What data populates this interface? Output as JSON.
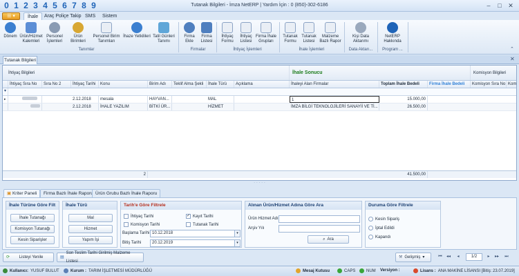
{
  "quick_numbers": [
    "0",
    "1",
    "2",
    "3",
    "4",
    "5",
    "6",
    "7",
    "8",
    "9"
  ],
  "window_title": "Tutanak Bilgileri - İmza NetERP | Yardım İçin : 0 (850)-302-6186",
  "app_menu_label": "☰ ▾",
  "ribbon_tabs": [
    "İhale",
    "Araç Poliçe Takip",
    "SMS",
    "Sistem"
  ],
  "ribbon": {
    "buttons": [
      {
        "label": "Dönem",
        "icon": "calendar-icon"
      },
      {
        "label": "Ürün/Hizmet Kalemleri",
        "icon": "products-icon"
      },
      {
        "label": "Personel İşlemleri",
        "icon": "person-icon"
      },
      {
        "label": "Ürün Birimleri",
        "icon": "coins-icon"
      },
      {
        "label": "Personel Birim Tanımları",
        "icon": "document-add-icon"
      },
      {
        "label": "İhaze Yetkilileri",
        "icon": "add-circle-icon"
      },
      {
        "label": "Tatil Günleri Tanımı",
        "icon": "holiday-icon"
      },
      {
        "label": "Firma Ekle",
        "icon": "firm-add-icon"
      },
      {
        "label": "Firma Listesi",
        "icon": "firm-list-icon"
      },
      {
        "label": "İhtiyaç Formu",
        "icon": "form-icon"
      },
      {
        "label": "İhtiyaç Listesi",
        "icon": "list-icon"
      },
      {
        "label": "Firma İhale Grupları",
        "icon": "group-icon"
      },
      {
        "label": "Tutanak Formu",
        "icon": "report-form-icon"
      },
      {
        "label": "Tutanak Listesi",
        "icon": "report-list-icon"
      },
      {
        "label": "Malzeme Bazlı Rapor",
        "icon": "chart-icon"
      },
      {
        "label": "Kişi Data Aktarımı",
        "icon": "transfer-icon"
      },
      {
        "label": "NetERP Hakkında",
        "icon": "info-icon"
      }
    ],
    "groups": [
      "Tanımlar",
      "Firmalar",
      "İhtiyaç İşlemleri",
      "İhale İşlemleri",
      "Data Aktarı...",
      "Program ..."
    ]
  },
  "doc_tab": "Tutanak Bilgileri",
  "grid": {
    "band_left": "İhtiyaç Bilgileri",
    "band_mid": "İhale Sonucu",
    "band_right": "Komisyon Bilgileri",
    "headers": [
      "İhtiyaç Sıra No",
      "Sıra No 2",
      "İhtiyaç Tarihi",
      "Konu",
      "Birim Adı",
      "Teklif Alma Şekli",
      "İhale Türü",
      "Açıklama",
      "İhaleyi Alan Firmalar",
      "Toplam İhale Bedeli",
      "Firma İhale Bedeli",
      "Komisyon Sıra No",
      "Komi"
    ],
    "rows": [
      {
        "date": "2.12.2018",
        "konu": "mesala",
        "birim": "HAYVAN...",
        "tur": "MAL",
        "firma": "1",
        "toplam": "15.000,00"
      },
      {
        "date": "2.12.2018",
        "konu": "İHALE YAZILIM",
        "birim": "BİTKİ ÜR...",
        "tur": "HİZMET",
        "firma": "İMZA BİLGİ TEKNOLOJİLERİ SANAYİİ VE Tİ...",
        "toplam": "26.500,00"
      }
    ],
    "footer_count": "2",
    "footer_total": "41.500,00"
  },
  "panel_tabs": [
    "Kriter Paneli",
    "Firma Bazlı İhale Raporu",
    "Ürün Grubu Bazlı İhale Raporu"
  ],
  "filters": {
    "ihale_turu_title": "İhale Türüne Göre Filt",
    "btn_ihale_tutanagi": "İhale Tutanağı",
    "btn_komisyon_tutanagi": "Komisyon Tutanağı",
    "btn_kesin_siparisler": "Kesin Siparişler",
    "ihale_turu2_title": "İhale Türü",
    "btn_mal": "Mal",
    "btn_hizmet": "Hizmet",
    "btn_yapim": "Yapım İşi",
    "tarih_title": "Tarih'e Göre Filtrele",
    "chk_ihtiyac": "İhtiyaç Tarihi",
    "chk_kayit": "Kayıt Tarihi",
    "chk_komisyon": "Komisyon Tarihi",
    "chk_tutanak": "Tutanak Tarihi",
    "lbl_baslama": "Başlama Tarihi",
    "val_baslama": "10.12.2018",
    "lbl_bitis": "Bitiş Tarihi",
    "val_bitis": "20.12.2019",
    "urun_title": "Alınan Ürün/Hizmet Adına Göre Ara",
    "lbl_urun": "Ürün Hizmet Adı",
    "lbl_aranan": "Arşiv Yılı",
    "btn_ara": "Ara",
    "durum_title": "Duruma Göre Filtrele",
    "rad_kesin": "Kesin Sipariş",
    "rad_iptal": "İptal Edildi",
    "rad_kapandi": "Kapandı"
  },
  "bottom": {
    "btn_refresh": "Listeyi Yenile",
    "btn_last": "Son Teslim Tarihi Girilmiş Malzeme Listesi",
    "btn_advanced": "Gelişmiş",
    "page": "1/2"
  },
  "status": {
    "user_label": "Kullanıcı:",
    "user": "YUSUF BULUT",
    "kurum_label": "Kurum :",
    "kurum": "TARIM İŞLETMESİ MÜDÜRLÜĞÜ",
    "mesaj": "Mesaj Kutusu",
    "caps": "CAPS",
    "num": "NUM",
    "versiyon": "Versiyon :",
    "lisans_label": "Lisans :",
    "lisans": "ANA MAKİNE LİSANSI [Bitiş: 23.07.2019]"
  },
  "colors": {
    "accent": "#1f64b8",
    "band_green": "#1a7a1a",
    "red_title": "#b42d1c",
    "blue_header": "#2f7fd6"
  }
}
